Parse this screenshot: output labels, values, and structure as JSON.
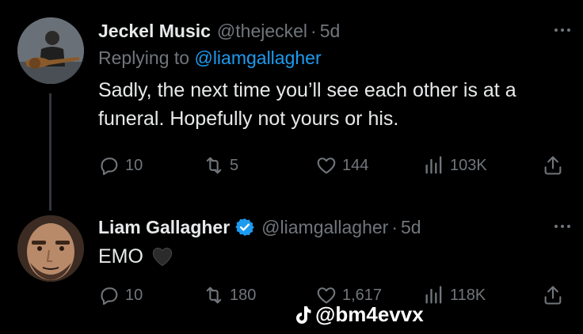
{
  "tweets": [
    {
      "name": "Jeckel Music",
      "handle": "@thejeckel",
      "separator": "·",
      "time": "5d",
      "replying_prefix": "Replying to ",
      "replying_to": "@liamgallagher",
      "text": "Sadly, the next time you’ll see each other is at a funeral. Hopefully not yours or his.",
      "stats": {
        "replies": "10",
        "retweets": "5",
        "likes": "144",
        "views": "103K"
      }
    },
    {
      "name": "Liam Gallagher",
      "handle": "@liamgallagher",
      "separator": "·",
      "time": "5d",
      "text": "EMO",
      "emoji": "black-heart",
      "verified": true,
      "stats": {
        "replies": "10",
        "retweets": "180",
        "likes": "1,617",
        "views": "118K"
      }
    }
  ],
  "watermark": {
    "handle": "@bm4evvx",
    "icon": "tiktok-icon"
  },
  "colors": {
    "background": "#000000",
    "text": "#e7e9ea",
    "muted": "#71767b",
    "accent": "#1d9bf0"
  }
}
